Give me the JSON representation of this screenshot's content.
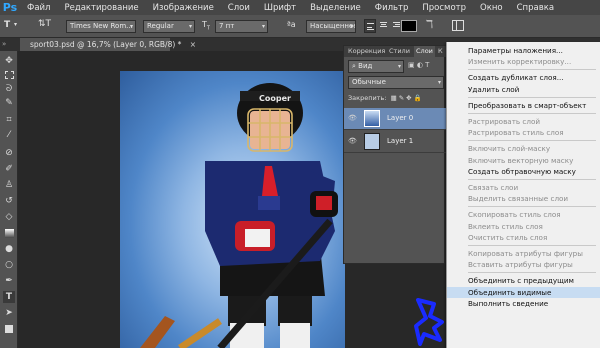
{
  "app": {
    "logo": "Ps"
  },
  "menubar": [
    "Файл",
    "Редактирование",
    "Изображение",
    "Слои",
    "Шрифт",
    "Выделение",
    "Фильтр",
    "Просмотр",
    "Окно",
    "Справка"
  ],
  "options": {
    "tool_glyph": "T",
    "font_family": "Times New Rom...",
    "font_style": "Regular",
    "font_size": "7 пт",
    "anti_alias": "Насыщенное"
  },
  "document": {
    "tab_title": "sport03.psd @ 16,7% (Layer 0, RGB/8) *",
    "close": "×"
  },
  "panel": {
    "tabs": [
      "Коррекция",
      "Стили",
      "Слои",
      "К"
    ],
    "active_tab": 2,
    "filter": "Вид",
    "blend_mode": "Обычные",
    "lock_label": "Закрепить:",
    "layers": [
      {
        "name": "Layer 0",
        "selected": true
      },
      {
        "name": "Layer 1",
        "selected": false
      }
    ]
  },
  "context_menu": {
    "items": [
      {
        "label": "Параметры наложения...",
        "disabled": false
      },
      {
        "label": "Изменить корректировку...",
        "disabled": true
      },
      {
        "sep": true
      },
      {
        "label": "Создать дубликат слоя...",
        "disabled": false
      },
      {
        "label": "Удалить слой",
        "disabled": false
      },
      {
        "sep": true
      },
      {
        "label": "Преобразовать в смарт-объект",
        "disabled": false
      },
      {
        "sep": true
      },
      {
        "label": "Растрировать слой",
        "disabled": true
      },
      {
        "label": "Растрировать стиль слоя",
        "disabled": true
      },
      {
        "sep": true
      },
      {
        "label": "Включить слой-маску",
        "disabled": true
      },
      {
        "label": "Включить векторную маску",
        "disabled": true
      },
      {
        "label": "Создать обтравочную маску",
        "disabled": false
      },
      {
        "sep": true
      },
      {
        "label": "Связать слои",
        "disabled": true
      },
      {
        "label": "Выделить связанные слои",
        "disabled": true
      },
      {
        "sep": true
      },
      {
        "label": "Скопировать стиль слоя",
        "disabled": true
      },
      {
        "label": "Вклеить стиль слоя",
        "disabled": true
      },
      {
        "label": "Очистить стиль слоя",
        "disabled": true
      },
      {
        "sep": true
      },
      {
        "label": "Копировать атрибуты фигуры",
        "disabled": true
      },
      {
        "label": "Вставить атрибуты фигуры",
        "disabled": true
      },
      {
        "sep": true
      },
      {
        "label": "Объединить с предыдущим",
        "disabled": false
      },
      {
        "label": "Объединить видимые",
        "disabled": false,
        "highlighted": true
      },
      {
        "label": "Выполнить сведение",
        "disabled": false
      }
    ]
  },
  "photo": {
    "helmet_text": "Cooper"
  },
  "colors": {
    "accent": "#31a8ff",
    "highlight": "#c7dcf2",
    "annotation": "#1a2bff"
  }
}
